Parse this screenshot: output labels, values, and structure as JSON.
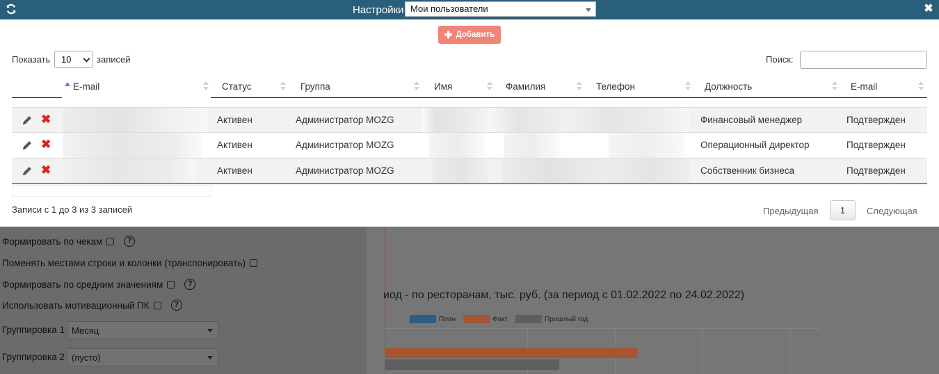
{
  "titlebar": {
    "title": "Настройки",
    "selected_view": "Мои пользователи"
  },
  "toolbar": {
    "add_label": "Добавить"
  },
  "table_controls": {
    "show_label": "Показать",
    "page_size": "10",
    "records_label": "записей",
    "search_label": "Поиск:",
    "search_value": ""
  },
  "table": {
    "columns": [
      "E-mail",
      "Статус",
      "Группа",
      "Имя",
      "Фамилия",
      "Телефон",
      "Должность",
      "E-mail"
    ],
    "rows": [
      {
        "status": "Активен",
        "group": "Администратор MOZG",
        "position": "Финансовый менеджер",
        "email_status": "Подтвержден"
      },
      {
        "status": "Активен",
        "group": "Администратор MOZG",
        "position": "Операционный директор",
        "email_status": "Подтвержден"
      },
      {
        "status": "Активен",
        "group": "Администратор MOZG",
        "position": "Собственник бизнеса",
        "email_status": "Подтвержден"
      }
    ]
  },
  "footer": {
    "info": "Записи с 1 до 3 из 3 записей",
    "prev_label": "Предыдущая",
    "current_page": "1",
    "next_label": "Следующая"
  },
  "background_form": {
    "opt_by_receipts": "Формировать по чекам",
    "opt_transpose": "Поменять местами строки и колонки (транспонировать)",
    "opt_averages": "Формировать по средним значениям",
    "opt_motivation": "Использовать мотивационный ПК",
    "grouping1_label": "Группировка 1",
    "grouping1_value": "Месяц",
    "grouping2_label": "Группировка 2",
    "grouping2_value": "(пусто)",
    "help_glyph": "?"
  },
  "background_chart": {
    "title": "иод - по ресторанам, тыс. руб. (за период с 01.02.2022 по 24.02.2022)",
    "legend": [
      "План",
      "Факт",
      "Прошлый год"
    ],
    "colors": {
      "plan": "#2e5d82",
      "fact": "#a65531",
      "last_year": "#5e5e5e"
    }
  },
  "colors": {
    "titlebar": "#2a5f7c",
    "add_button": "#f08577",
    "delete_icon": "#e02323"
  }
}
